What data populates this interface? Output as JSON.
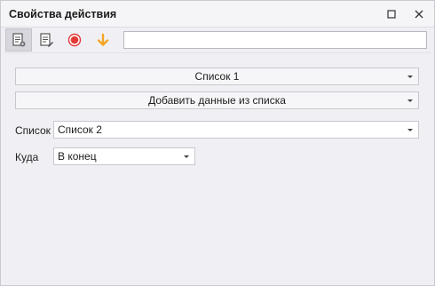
{
  "window": {
    "title": "Свойства действия"
  },
  "titlebar_buttons": [
    {
      "icon": "maximize-icon"
    },
    {
      "icon": "close-icon"
    }
  ],
  "toolbar": {
    "tools": [
      {
        "icon": "action-properties-icon",
        "active": true
      },
      {
        "icon": "edit-notes-icon",
        "active": false
      },
      {
        "icon": "record-icon",
        "active": false,
        "color": "#e53935"
      },
      {
        "icon": "arrow-down-icon",
        "active": false,
        "color": "#f5a623"
      }
    ],
    "search_value": ""
  },
  "main": {
    "source_list_selector": "Список 1",
    "operation_selector": "Добавить данные из списка",
    "list_label": "Список",
    "list_value": "Список 2",
    "where_label": "Куда",
    "where_value": "В конец"
  }
}
